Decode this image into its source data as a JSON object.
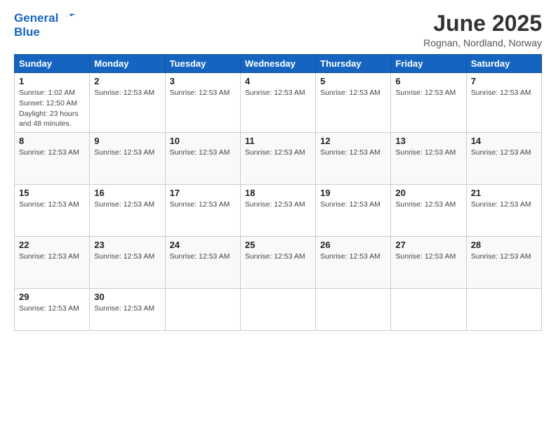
{
  "logo": {
    "line1": "General",
    "line2": "Blue"
  },
  "title": "June 2025",
  "subtitle": "Rognan, Nordland, Norway",
  "days_of_week": [
    "Sunday",
    "Monday",
    "Tuesday",
    "Wednesday",
    "Thursday",
    "Friday",
    "Saturday"
  ],
  "weeks": [
    [
      {
        "num": "1",
        "info": "Sunrise: 1:02 AM\nSunset: 12:50 AM\nDaylight: 23 hours and 48 minutes.",
        "empty": false
      },
      {
        "num": "2",
        "info": "Sunrise: 12:53 AM",
        "empty": false
      },
      {
        "num": "3",
        "info": "Sunrise: 12:53 AM",
        "empty": false
      },
      {
        "num": "4",
        "info": "Sunrise: 12:53 AM",
        "empty": false
      },
      {
        "num": "5",
        "info": "Sunrise: 12:53 AM",
        "empty": false
      },
      {
        "num": "6",
        "info": "Sunrise: 12:53 AM",
        "empty": false
      },
      {
        "num": "7",
        "info": "Sunrise: 12:53 AM",
        "empty": false
      }
    ],
    [
      {
        "num": "8",
        "info": "Sunrise: 12:53 AM",
        "empty": false
      },
      {
        "num": "9",
        "info": "Sunrise: 12:53 AM",
        "empty": false
      },
      {
        "num": "10",
        "info": "Sunrise: 12:53 AM",
        "empty": false
      },
      {
        "num": "11",
        "info": "Sunrise: 12:53 AM",
        "empty": false
      },
      {
        "num": "12",
        "info": "Sunrise: 12:53 AM",
        "empty": false
      },
      {
        "num": "13",
        "info": "Sunrise: 12:53 AM",
        "empty": false
      },
      {
        "num": "14",
        "info": "Sunrise: 12:53 AM",
        "empty": false
      }
    ],
    [
      {
        "num": "15",
        "info": "Sunrise: 12:53 AM",
        "empty": false
      },
      {
        "num": "16",
        "info": "Sunrise: 12:53 AM",
        "empty": false
      },
      {
        "num": "17",
        "info": "Sunrise: 12:53 AM",
        "empty": false
      },
      {
        "num": "18",
        "info": "Sunrise: 12:53 AM",
        "empty": false
      },
      {
        "num": "19",
        "info": "Sunrise: 12:53 AM",
        "empty": false
      },
      {
        "num": "20",
        "info": "Sunrise: 12:53 AM",
        "empty": false
      },
      {
        "num": "21",
        "info": "Sunrise: 12:53 AM",
        "empty": false
      }
    ],
    [
      {
        "num": "22",
        "info": "Sunrise: 12:53 AM",
        "empty": false
      },
      {
        "num": "23",
        "info": "Sunrise: 12:53 AM",
        "empty": false
      },
      {
        "num": "24",
        "info": "Sunrise: 12:53 AM",
        "empty": false
      },
      {
        "num": "25",
        "info": "Sunrise: 12:53 AM",
        "empty": false
      },
      {
        "num": "26",
        "info": "Sunrise: 12:53 AM",
        "empty": false
      },
      {
        "num": "27",
        "info": "Sunrise: 12:53 AM",
        "empty": false
      },
      {
        "num": "28",
        "info": "Sunrise: 12:53 AM",
        "empty": false
      }
    ],
    [
      {
        "num": "29",
        "info": "Sunrise: 12:53 AM",
        "empty": false
      },
      {
        "num": "30",
        "info": "Sunrise: 12:53 AM",
        "empty": false
      },
      {
        "num": "",
        "info": "",
        "empty": true
      },
      {
        "num": "",
        "info": "",
        "empty": true
      },
      {
        "num": "",
        "info": "",
        "empty": true
      },
      {
        "num": "",
        "info": "",
        "empty": true
      },
      {
        "num": "",
        "info": "",
        "empty": true
      }
    ]
  ]
}
